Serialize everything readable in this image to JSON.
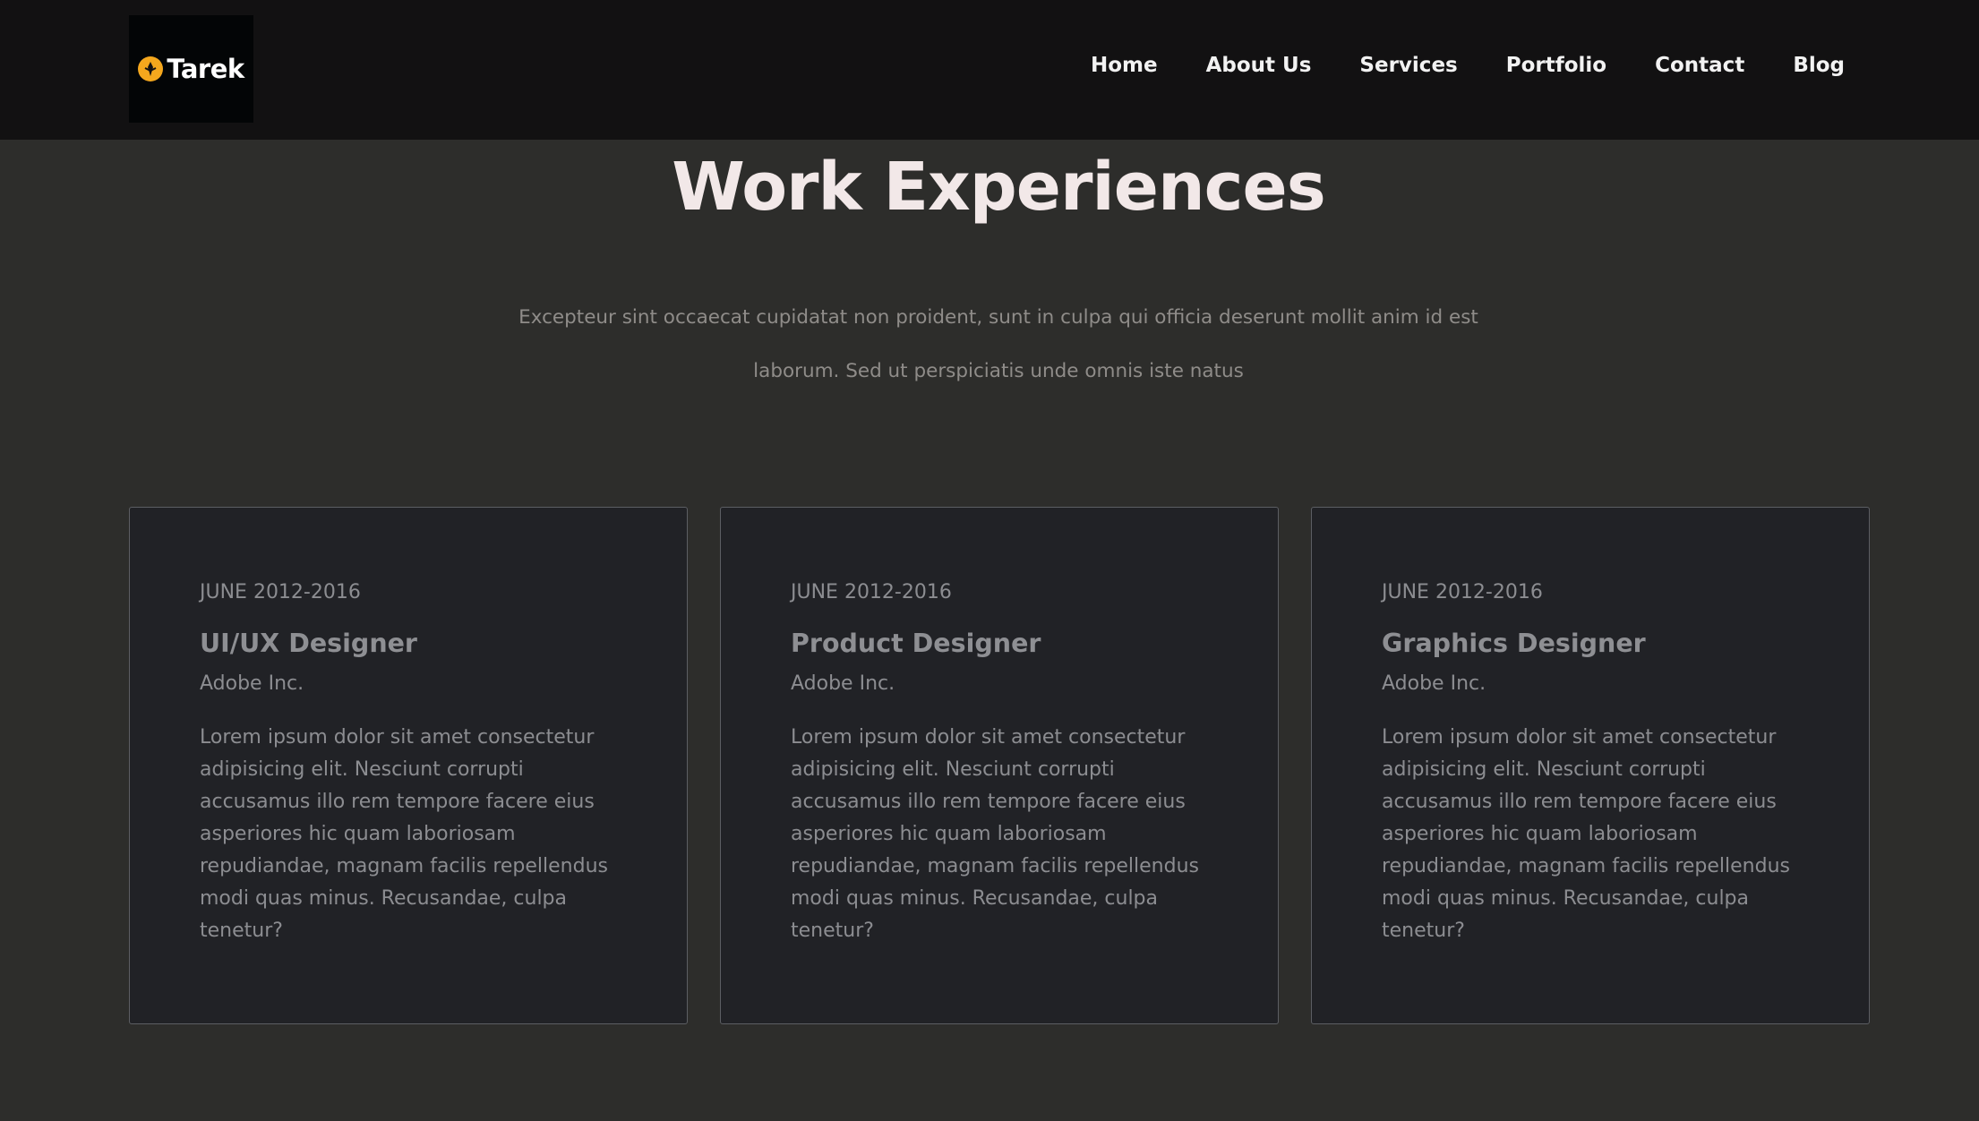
{
  "brand": {
    "name": "Tarek",
    "icon": "logo-emblem-icon",
    "accent": "#f4a71d"
  },
  "nav": {
    "items": [
      {
        "label": "Home"
      },
      {
        "label": "About Us"
      },
      {
        "label": "Services"
      },
      {
        "label": "Portfolio"
      },
      {
        "label": "Contact"
      },
      {
        "label": "Blog"
      }
    ]
  },
  "section": {
    "title": "Work Experiences",
    "subtitle": "Excepteur sint occaecat cupidatat non proident, sunt in culpa qui officia deserunt mollit anim id est laborum. Sed ut perspiciatis unde omnis iste natus"
  },
  "experiences": [
    {
      "date": "JUNE 2012-2016",
      "role": "UI/UX Designer",
      "company": "Adobe Inc.",
      "description": "Lorem ipsum dolor sit amet consectetur adipisicing elit. Nesciunt corrupti accusamus illo rem tempore facere eius asperiores hic quam laboriosam repudiandae, magnam facilis repellendus modi quas minus. Recusandae, culpa tenetur?"
    },
    {
      "date": "JUNE 2012-2016",
      "role": "Product Designer",
      "company": "Adobe Inc.",
      "description": "Lorem ipsum dolor sit amet consectetur adipisicing elit. Nesciunt corrupti accusamus illo rem tempore facere eius asperiores hic quam laboriosam repudiandae, magnam facilis repellendus modi quas minus. Recusandae, culpa tenetur?"
    },
    {
      "date": "JUNE 2012-2016",
      "role": "Graphics Designer",
      "company": "Adobe Inc.",
      "description": "Lorem ipsum dolor sit amet consectetur adipisicing elit. Nesciunt corrupti accusamus illo rem tempore facere eius asperiores hic quam laboriosam repudiandae, magnam facilis repellendus modi quas minus. Recusandae, culpa tenetur?"
    }
  ]
}
